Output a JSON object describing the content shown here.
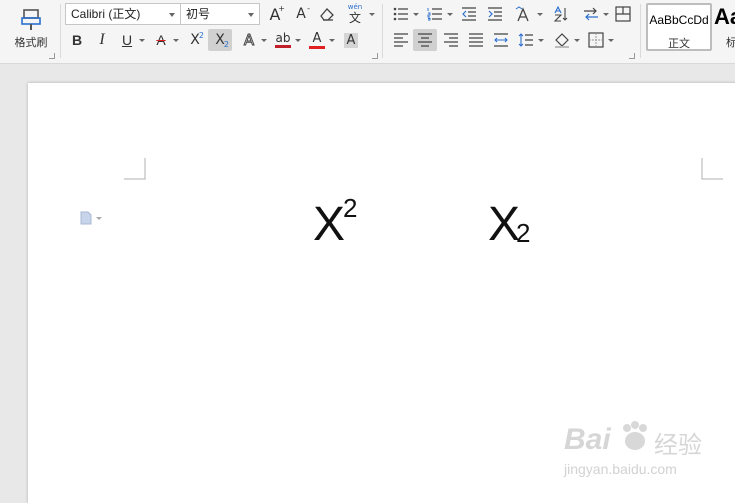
{
  "ribbon": {
    "format_painter_label": "格式刷",
    "font_name": "Calibri (正文)",
    "font_size": "初号",
    "style_sample": "AaBbCcDd",
    "style_name": "正文",
    "style_next_sample": "Aa",
    "style_next_name": "标",
    "bold": "B",
    "italic": "I",
    "underline": "U",
    "grow_font": "A",
    "shrink_font": "A",
    "pinyin": "wén",
    "pinyin_char": "文",
    "font_color_glyph": "A",
    "highlight_glyph": "ab",
    "shading_glyph": "A",
    "text_effect_glyph": "A",
    "strike_glyph": "A",
    "superscript_glyph": "X",
    "subscript_glyph": "X",
    "colors": {
      "font_color": "#e02020",
      "highlight": "#c0202a",
      "active": "#d0d0d0",
      "accent": "#2b6fce"
    }
  },
  "document": {
    "superscript_base": "X",
    "superscript_exp": "2",
    "subscript_base": "X",
    "subscript_idx": "2"
  },
  "watermark": {
    "brand": "Bai",
    "brand2": "经验",
    "url": "jingyan.baidu.com"
  }
}
